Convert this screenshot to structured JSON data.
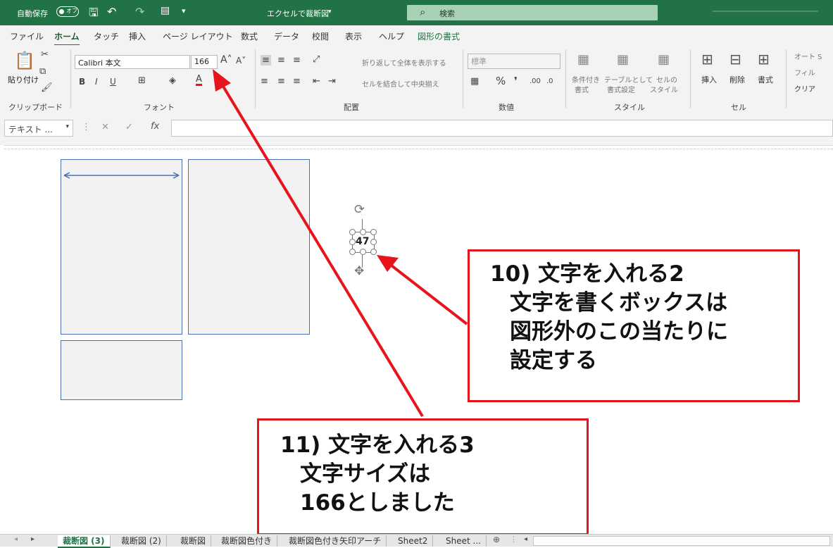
{
  "titlebar": {
    "autosave_label": "自動保存",
    "autosave_state": "オフ",
    "doc_title": "エクセルで裁断図",
    "search_placeholder": "検索"
  },
  "menu_tabs": [
    "ファイル",
    "ホーム",
    "タッチ",
    "挿入",
    "ページ レイアウト",
    "数式",
    "データ",
    "校閲",
    "表示",
    "ヘルプ",
    "図形の書式"
  ],
  "ribbon": {
    "paste_label": "貼り付け",
    "clipboard_group": "クリップボード",
    "font_name": "Calibri 本文",
    "font_size": "166",
    "font_group": "フォント",
    "wrap_text": "折り返して全体を表示する",
    "merge_center": "セルを結合して中央揃え",
    "alignment_group": "配置",
    "number_format": "標準",
    "number_group": "数値",
    "cond_format": "条件付き",
    "cond_format2": "書式",
    "table_format": "テーブルとして",
    "table_format2": "書式設定",
    "cell_style": "セルの",
    "cell_style2": "スタイル",
    "style_group": "スタイル",
    "insert": "挿入",
    "delete": "削除",
    "format": "書式",
    "cells_group": "セル",
    "autosum": "オート S",
    "fill": "フィル",
    "clear": "クリア"
  },
  "formula_bar": {
    "name_box": "テキスト ..."
  },
  "sheet": {
    "textbox_value": "47"
  },
  "callouts": {
    "c10": [
      "10) 文字を入れる2",
      "文字を書くボックスは",
      "図形外のこの当たりに",
      "設定する"
    ],
    "c11": [
      "11) 文字を入れる3",
      "文字サイズは",
      "166としました"
    ]
  },
  "sheet_tabs": [
    "裁断図 (3)",
    "裁断図 (2)",
    "裁断図",
    "裁断図色付き",
    "裁断図色付き矢印アーチ",
    "Sheet2",
    "Sheet ..."
  ],
  "colors": {
    "excel_green": "#217346",
    "callout_red": "#e8141c",
    "shape_border": "#4c6fb0"
  }
}
